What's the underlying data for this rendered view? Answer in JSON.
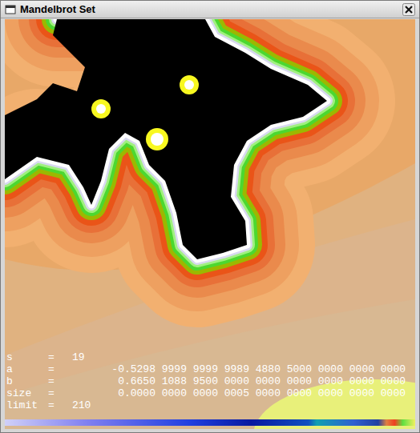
{
  "window": {
    "title": "Mandelbrot Set"
  },
  "info": [
    {
      "label": "s",
      "separator": "=",
      "value": "19",
      "kind": "short"
    },
    {
      "label": "a",
      "separator": "=",
      "value": "-0.5298 9999 9999 9989 4880 5000 0000 0000 0000",
      "kind": "long"
    },
    {
      "label": "b",
      "separator": "=",
      "value": "0.6650 1088 9500 0000 0000 0000 0000 0000 0000",
      "kind": "long"
    },
    {
      "label": "size",
      "separator": "=",
      "value": "0.0000 0000 0000 0005 0000 0000 0000 0000 0000",
      "kind": "long"
    },
    {
      "label": "limit",
      "separator": "=",
      "value": "210",
      "kind": "short"
    }
  ]
}
